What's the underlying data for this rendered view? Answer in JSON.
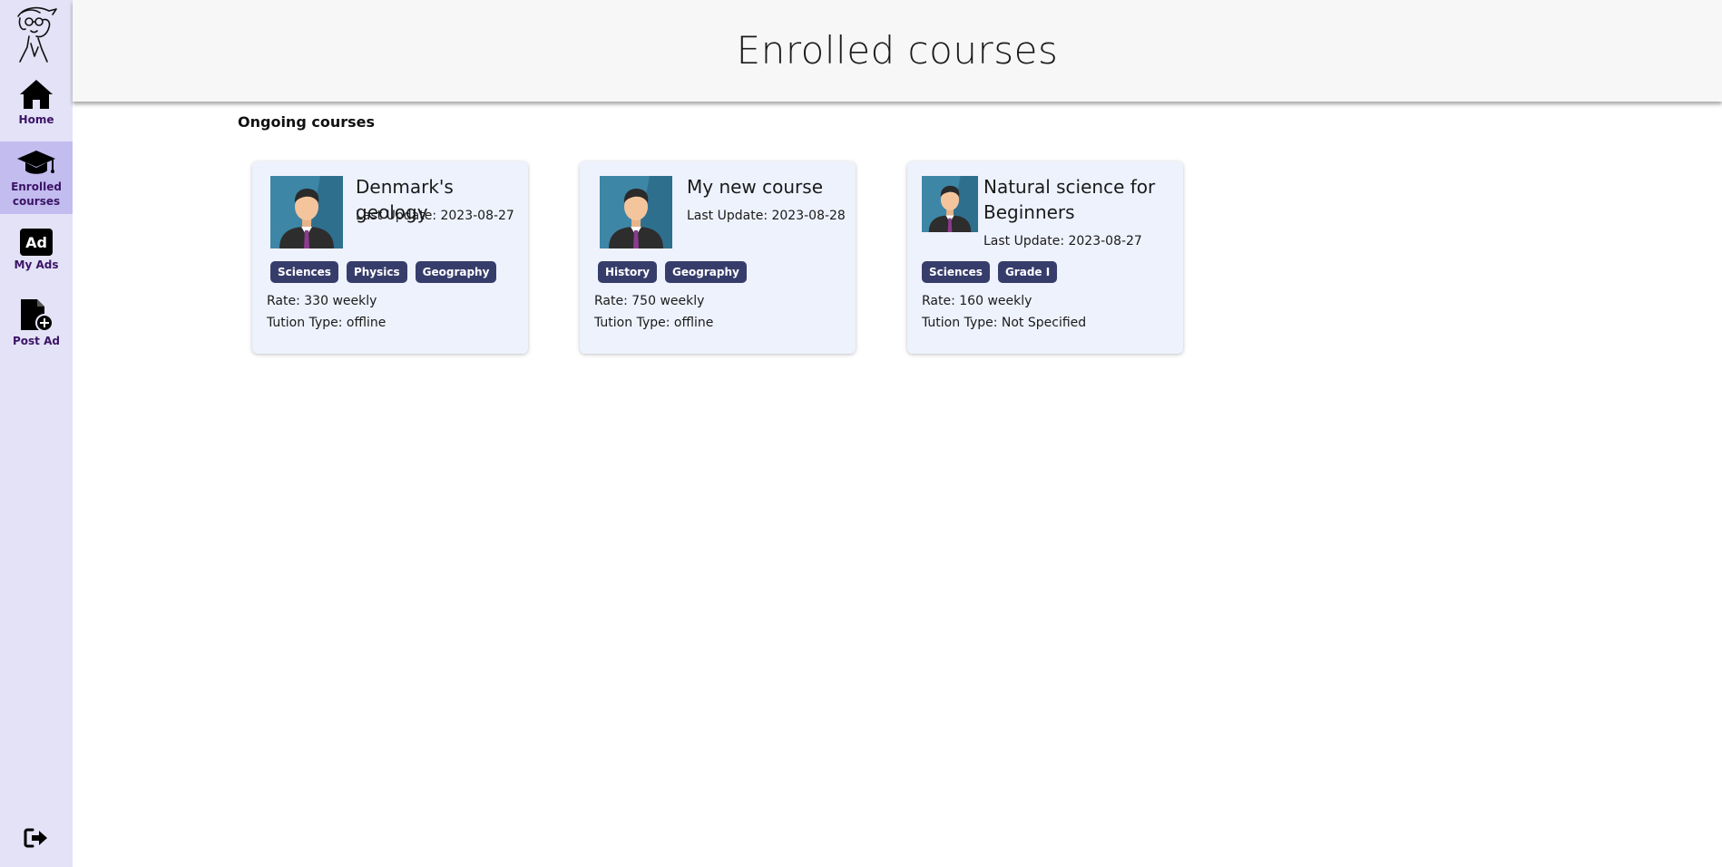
{
  "sidebar": {
    "items": [
      {
        "label": "Home",
        "icon": "home-icon"
      },
      {
        "label": "Enrolled courses",
        "icon": "graduation-cap-icon",
        "active": true
      },
      {
        "label": "My Ads",
        "icon": "ad-icon"
      },
      {
        "label": "Post Ad",
        "icon": "file-plus-icon"
      }
    ],
    "logout_icon": "logout-icon",
    "logo_icon": "sketch-avatar-logo"
  },
  "header": {
    "title": "Enrolled courses"
  },
  "main": {
    "section_title": "Ongoing courses",
    "courses": [
      {
        "title": "Denmark's geology",
        "last_update": "Last Update: 2023-08-27",
        "tags": [
          "Sciences",
          "Physics",
          "Geography"
        ],
        "rate": "Rate: 330 weekly",
        "tution_type": "Tution Type: offline"
      },
      {
        "title": "My new course",
        "last_update": "Last Update: 2023-08-28",
        "tags": [
          "History",
          "Geography"
        ],
        "rate": "Rate: 750 weekly",
        "tution_type": "Tution Type: offline"
      },
      {
        "title": "Natural science for Beginners",
        "last_update": "Last Update: 2023-08-27",
        "tags": [
          "Sciences",
          "Grade I"
        ],
        "rate": "Rate: 160 weekly",
        "tution_type": "Tution Type: Not Specified"
      }
    ]
  },
  "colors": {
    "sidebar_bg": "#e3e2f7",
    "sidebar_active": "#c3bcef",
    "nav_label": "#3b1466",
    "card_bg": "#eef2fd",
    "tag_bg": "#373d6b",
    "header_bg": "#f7f7f7"
  }
}
